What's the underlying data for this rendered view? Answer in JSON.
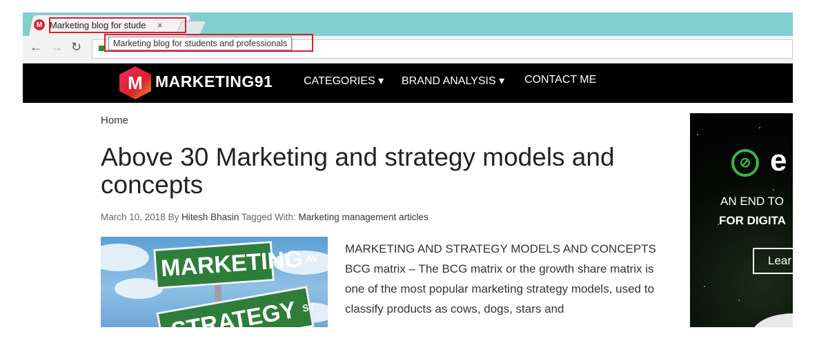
{
  "browser": {
    "tab_title": "Marketing blog for stude",
    "tab_close": "×",
    "tab_favicon": "M",
    "tooltip": "Marketing blog for students and professionals",
    "back": "←",
    "forward": "→",
    "reload": "↻",
    "accent_color": "#80d0cf",
    "highlight_color": "#d21f2e"
  },
  "site": {
    "logo_letter": "M",
    "logo_text": "MARKETING91",
    "nav": [
      {
        "label": "CATEGORIES ▾"
      },
      {
        "label": "BRAND ANALYSIS ▾"
      },
      {
        "label": "CONTACT ME"
      }
    ]
  },
  "article": {
    "breadcrumb": "Home",
    "title": "Above 30 Marketing and strategy models and concepts",
    "date": "March 10, 2018",
    "by": "By",
    "author": "Hitesh Bhasin",
    "tagged": "Tagged With:",
    "tag": "Marketing management articles",
    "image_sign1": "MARKETING",
    "image_sign1_suffix": "AV",
    "image_sign2": "STRATEGY",
    "image_sign2_suffix": "ST",
    "excerpt": "MARKETING AND STRATEGY MODELS AND CONCEPTS BCG matrix – The BCG matrix or the growth share matrix is one of the most popular marketing strategy models, used to classify products as cows, dogs, stars and"
  },
  "ad": {
    "icon": "⊘",
    "letter": "e",
    "line1": "AN END TO",
    "line2": "FOR DIGITA",
    "button": "Lear"
  }
}
